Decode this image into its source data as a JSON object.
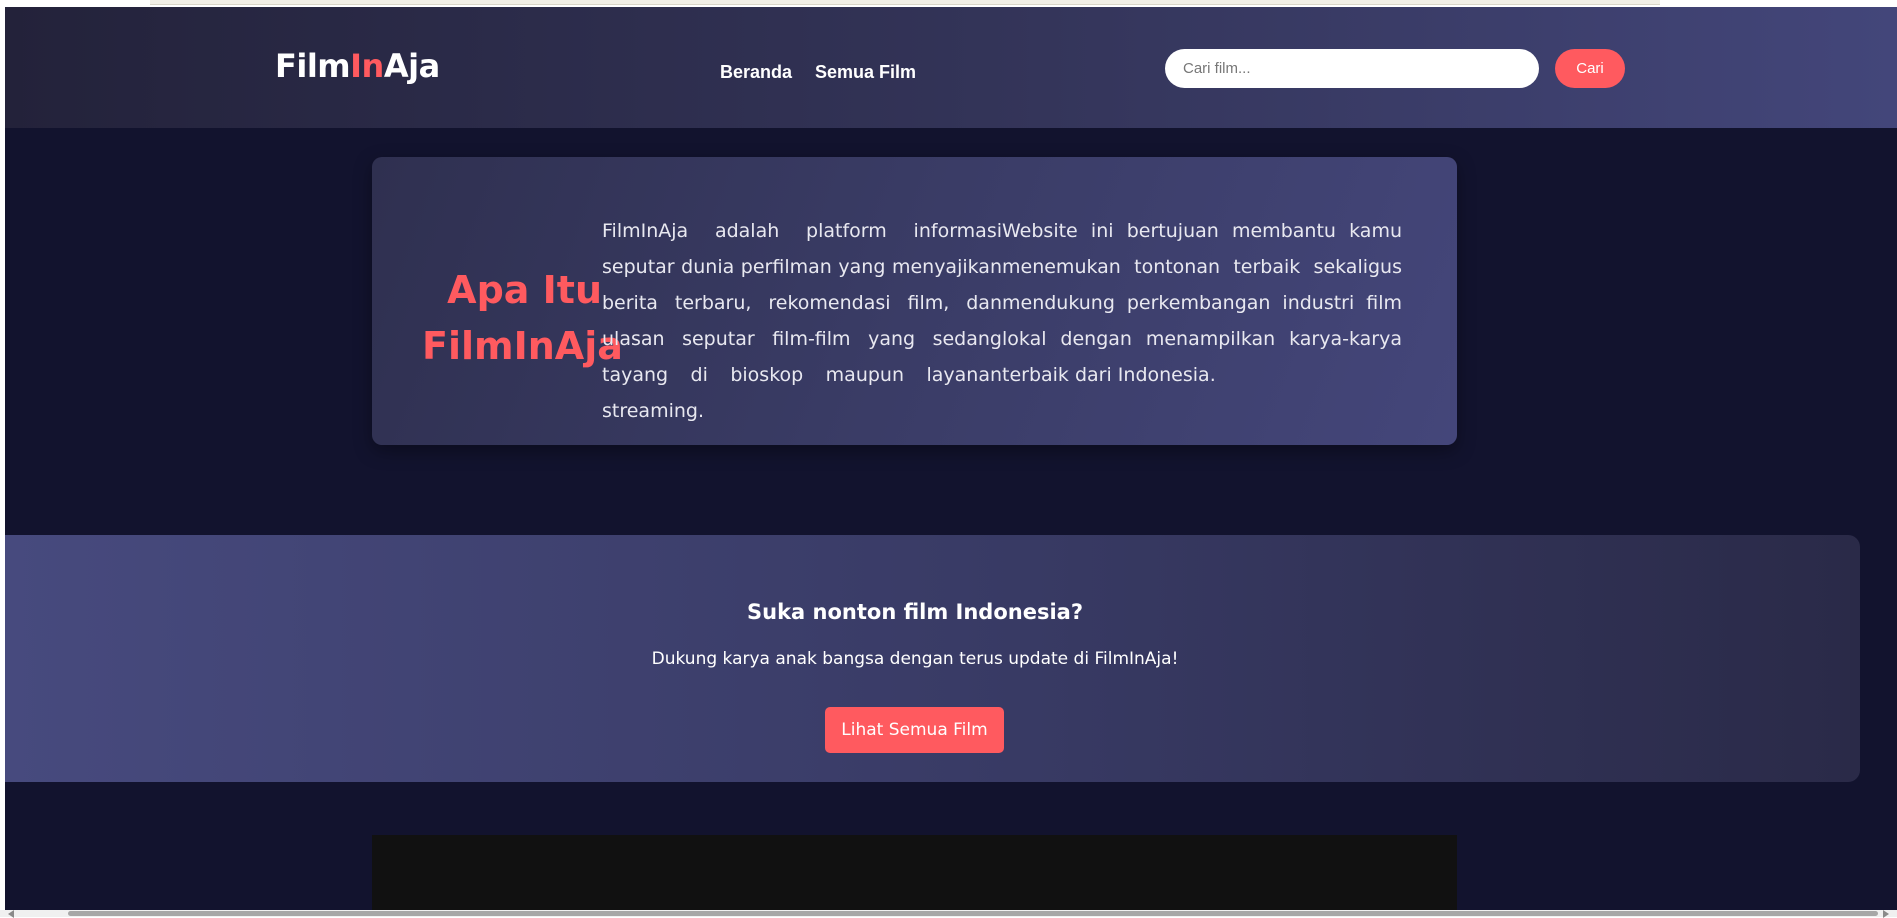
{
  "brand": {
    "logo_part1": "Film",
    "logo_part2": "In",
    "logo_part3": "Aja",
    "accent_color": "#ff5a5f"
  },
  "nav": {
    "items": [
      {
        "label": "Beranda"
      },
      {
        "label": "Semua Film"
      }
    ]
  },
  "search": {
    "placeholder": "Cari film...",
    "value": "",
    "button_label": "Cari"
  },
  "about": {
    "title": "Apa Itu FilmInAja",
    "col1": "FilmInAja adalah platform informasi seputar dunia perfilman yang menyajikan berita terbaru, rekomendasi film, dan ulasan seputar film-film yang sedang tayang di bioskop maupun layanan streaming.",
    "col2": "Website ini bertujuan membantu kamu menemukan tontonan terbaik sekaligus mendukung perkembangan industri film lokal dengan menampilkan karya-karya terbaik dari Indonesia."
  },
  "cta": {
    "title": "Suka nonton film Indonesia?",
    "text": "Dukung karya anak bangsa dengan terus update di FilmInAja!",
    "button_label": "Lihat Semua Film"
  },
  "colors": {
    "page_bg": "#12132e",
    "button_bg": "#ff5a5f",
    "panel_bg": "#111111"
  }
}
